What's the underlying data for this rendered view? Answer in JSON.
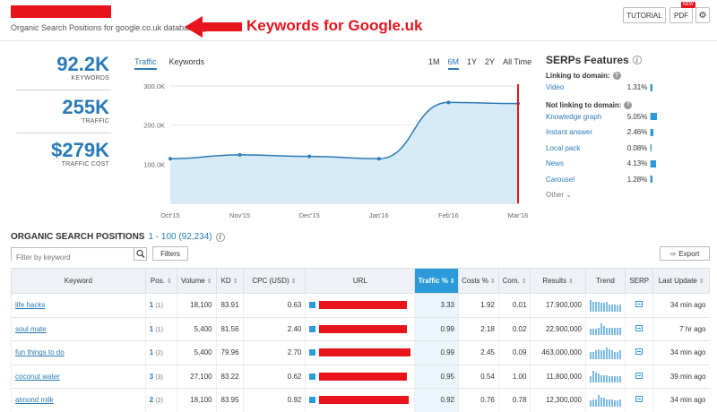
{
  "header": {
    "subtitle": "Organic Search Positions for google.co.uk database",
    "annotation": "Keywords for Google.uk",
    "buttons": {
      "tutorial": "TUTORIAL",
      "pdf": "PDF",
      "new_badge": "NEW"
    },
    "colors": {
      "redaction": "#e8141c",
      "accent": "#2a7ab8"
    }
  },
  "metrics": [
    {
      "value": "92.2K",
      "label": "KEYWORDS"
    },
    {
      "value": "255K",
      "label": "TRAFFIC"
    },
    {
      "value": "$279K",
      "label": "TRAFFIC COST"
    }
  ],
  "chart_tabs": {
    "traffic": "Traffic",
    "keywords": "Keywords"
  },
  "range_tabs": [
    "1M",
    "6M",
    "1Y",
    "2Y",
    "All Time"
  ],
  "range_selected": "6M",
  "chart_data": {
    "type": "area",
    "categories": [
      "Oct'15",
      "Nov'15",
      "Dec'15",
      "Jan'16",
      "Feb'16",
      "Mar'16"
    ],
    "x_positions": [
      0,
      0.5,
      1.5,
      2.5,
      3.0,
      4.0,
      5.0
    ],
    "values": [
      114000,
      124000,
      120000,
      114000,
      258000,
      255000
    ],
    "y_ticks": [
      "100.0K",
      "200.0K",
      "300.0K"
    ],
    "ylim": [
      0,
      300000
    ],
    "highlight_category": "Mar'16",
    "series_color": "#2a7ab8",
    "fill_color": "#d6eaf8",
    "marker_color": "#e8141c"
  },
  "serp": {
    "title": "SERPs Features",
    "linking_label": "Linking to domain:",
    "not_linking_label": "Not linking to domain:",
    "linking": [
      {
        "name": "Video",
        "pct": "1.31%",
        "frac": 0.0131
      }
    ],
    "not_linking": [
      {
        "name": "Knowledge graph",
        "pct": "5.05%",
        "frac": 0.0505
      },
      {
        "name": "Instant answer",
        "pct": "2.46%",
        "frac": 0.0246
      },
      {
        "name": "Local pack",
        "pct": "0.08%",
        "frac": 0.0008
      },
      {
        "name": "News",
        "pct": "4.13%",
        "frac": 0.0413
      },
      {
        "name": "Carousel",
        "pct": "1.28%",
        "frac": 0.0128
      }
    ],
    "other": "Other ⌄"
  },
  "positions": {
    "title": "ORGANIC SEARCH POSITIONS",
    "range": "1 - 100 (92,234)",
    "filter_placeholder": "Filter by keyword",
    "filters_button": "Filters",
    "export_button": "Export",
    "columns": [
      "Keyword",
      "Pos.",
      "Volume",
      "KD",
      "CPC (USD)",
      "URL",
      "Traffic %",
      "Costs %",
      "Com.",
      "Results",
      "Trend",
      "SERP",
      "Last Update"
    ],
    "rows": [
      {
        "keyword": "life hacks",
        "pos": "1",
        "prev": "(1)",
        "volume": "18,100",
        "kd": "83.91",
        "cpc": "0.63",
        "traffic": "3.33",
        "costs": "1.92",
        "com": "0.01",
        "results": "17,900,000",
        "updated": "34 min ago",
        "trend": [
          0.9,
          0.8,
          0.8,
          0.8,
          0.7,
          0.7,
          0.8,
          0.6,
          0.6,
          0.6,
          0.5,
          0.6
        ]
      },
      {
        "keyword": "soul mate",
        "pos": "1",
        "prev": "(1)",
        "volume": "5,400",
        "kd": "81.56",
        "cpc": "2.40",
        "traffic": "0.99",
        "costs": "2.18",
        "com": "0.02",
        "results": "22,900,000",
        "updated": "7 hr ago",
        "trend": [
          0.5,
          0.5,
          0.5,
          0.6,
          0.9,
          0.7,
          0.6,
          0.6,
          0.6,
          0.6,
          0.6,
          0.6
        ]
      },
      {
        "keyword": "fun things to do",
        "pos": "1",
        "prev": "(2)",
        "volume": "5,400",
        "kd": "79.96",
        "cpc": "2.70",
        "traffic": "0.99",
        "costs": "2.45",
        "com": "0.09",
        "results": "463,000,000",
        "updated": "34 min ago",
        "trend": [
          0.6,
          0.6,
          0.7,
          0.8,
          0.7,
          0.7,
          0.9,
          0.8,
          0.7,
          0.6,
          0.6,
          0.7
        ]
      },
      {
        "keyword": "coconut water",
        "pos": "3",
        "prev": "(3)",
        "volume": "27,100",
        "kd": "83.22",
        "cpc": "0.62",
        "traffic": "0.95",
        "costs": "0.54",
        "com": "1.00",
        "results": "11,800,000",
        "updated": "39 min ago",
        "trend": [
          0.5,
          0.9,
          0.8,
          0.7,
          0.6,
          0.6,
          0.6,
          0.5,
          0.5,
          0.5,
          0.5,
          0.5
        ]
      },
      {
        "keyword": "almond milk",
        "pos": "2",
        "prev": "(2)",
        "volume": "18,100",
        "kd": "83.95",
        "cpc": "0.92",
        "traffic": "0.92",
        "costs": "0.76",
        "com": "0.78",
        "results": "12,300,000",
        "updated": "34 min ago",
        "trend": [
          0.5,
          0.6,
          0.6,
          0.9,
          0.7,
          0.7,
          0.6,
          0.6,
          0.6,
          0.5,
          0.5,
          0.6
        ]
      }
    ]
  }
}
